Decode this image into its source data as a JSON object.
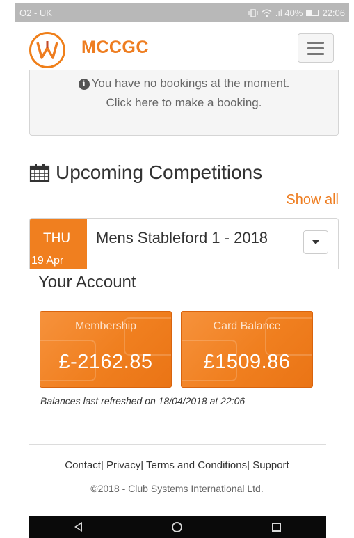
{
  "status_bar": {
    "carrier": "O2 - UK",
    "signal_text": ".ıl 40%",
    "battery_percent": 40,
    "time": "22:06"
  },
  "header": {
    "brand": "MCCGC"
  },
  "bookings": {
    "line1": "You have no bookings at the moment.",
    "line2": "Click here to make a booking."
  },
  "competitions": {
    "heading": "Upcoming Competitions",
    "show_all": "Show all",
    "items": [
      {
        "day": "THU",
        "date": "19 Apr",
        "name": "Mens Stableford 1 - 2018"
      }
    ]
  },
  "account": {
    "title": "Your Account",
    "membership_label": "Membership",
    "membership_value": "£-2162.85",
    "card_label": "Card Balance",
    "card_value": "£1509.86",
    "refresh_note": "Balances last refreshed on 18/04/2018 at 22:06"
  },
  "footer": {
    "links": [
      "Contact",
      "Privacy",
      "Terms and Conditions",
      "Support"
    ],
    "copyright": "©2018 - Club Systems International Ltd."
  },
  "colors": {
    "accent": "#ee7d20",
    "tile": "#f07f1f"
  }
}
